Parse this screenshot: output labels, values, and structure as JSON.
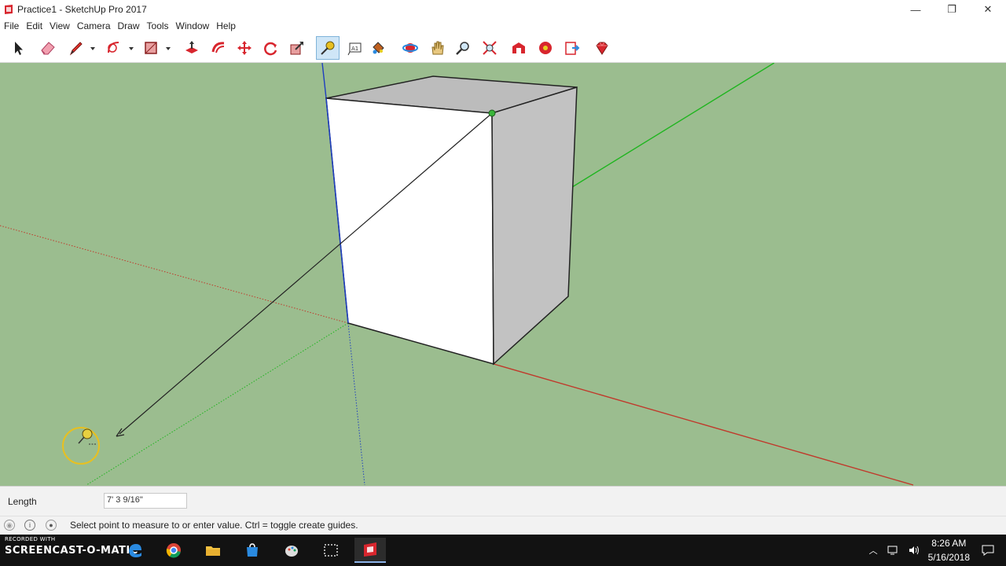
{
  "window": {
    "title": "Practice1 - SketchUp Pro 2017",
    "minimize": "—",
    "restore": "❐",
    "close": "✕"
  },
  "menu": [
    "File",
    "Edit",
    "View",
    "Camera",
    "Draw",
    "Tools",
    "Window",
    "Help"
  ],
  "toolbar": {
    "tools": [
      {
        "icon": "select-arrow-icon"
      },
      {
        "icon": "eraser-icon"
      },
      {
        "icon": "pencil-line-icon"
      },
      {
        "icon": "arc-icon"
      },
      {
        "icon": "rectangle-shape-icon"
      },
      {
        "icon": "push-pull-icon"
      },
      {
        "icon": "offset-icon"
      },
      {
        "icon": "move-icon"
      },
      {
        "icon": "rotate-icon"
      },
      {
        "icon": "scale-icon"
      },
      {
        "icon": "tape-measure-icon",
        "active": true
      },
      {
        "icon": "text-icon"
      },
      {
        "icon": "paint-bucket-icon"
      },
      {
        "icon": "orbit-icon"
      },
      {
        "icon": "pan-hand-icon"
      },
      {
        "icon": "zoom-icon"
      },
      {
        "icon": "zoom-extents-icon"
      },
      {
        "icon": "warehouse-icon"
      },
      {
        "icon": "extension-warehouse-icon"
      },
      {
        "icon": "send-to-layout-icon"
      },
      {
        "icon": "ruby-icon"
      }
    ],
    "text_tool_glyph": "A1"
  },
  "vcb": {
    "label": "Length",
    "value": "7' 3 9/16\""
  },
  "status": {
    "message": "Select point to measure to or enter value.  Ctrl = toggle create guides."
  },
  "taskbar": {
    "watermark_top": "RECORDED WITH",
    "watermark_brand": "SCREENCAST-O-MATIC",
    "apps": [
      "edge-browser-icon",
      "chrome-icon",
      "file-explorer-icon",
      "store-icon",
      "paint-icon",
      "snipping-icon",
      "sketchup-icon"
    ],
    "time": "8:26 AM",
    "date": "5/16/2018"
  },
  "colors": {
    "ground": "#9bbd8f",
    "red_axis": "#c0392b",
    "green_axis": "#1fb51f",
    "blue_axis": "#1f3fbf"
  }
}
